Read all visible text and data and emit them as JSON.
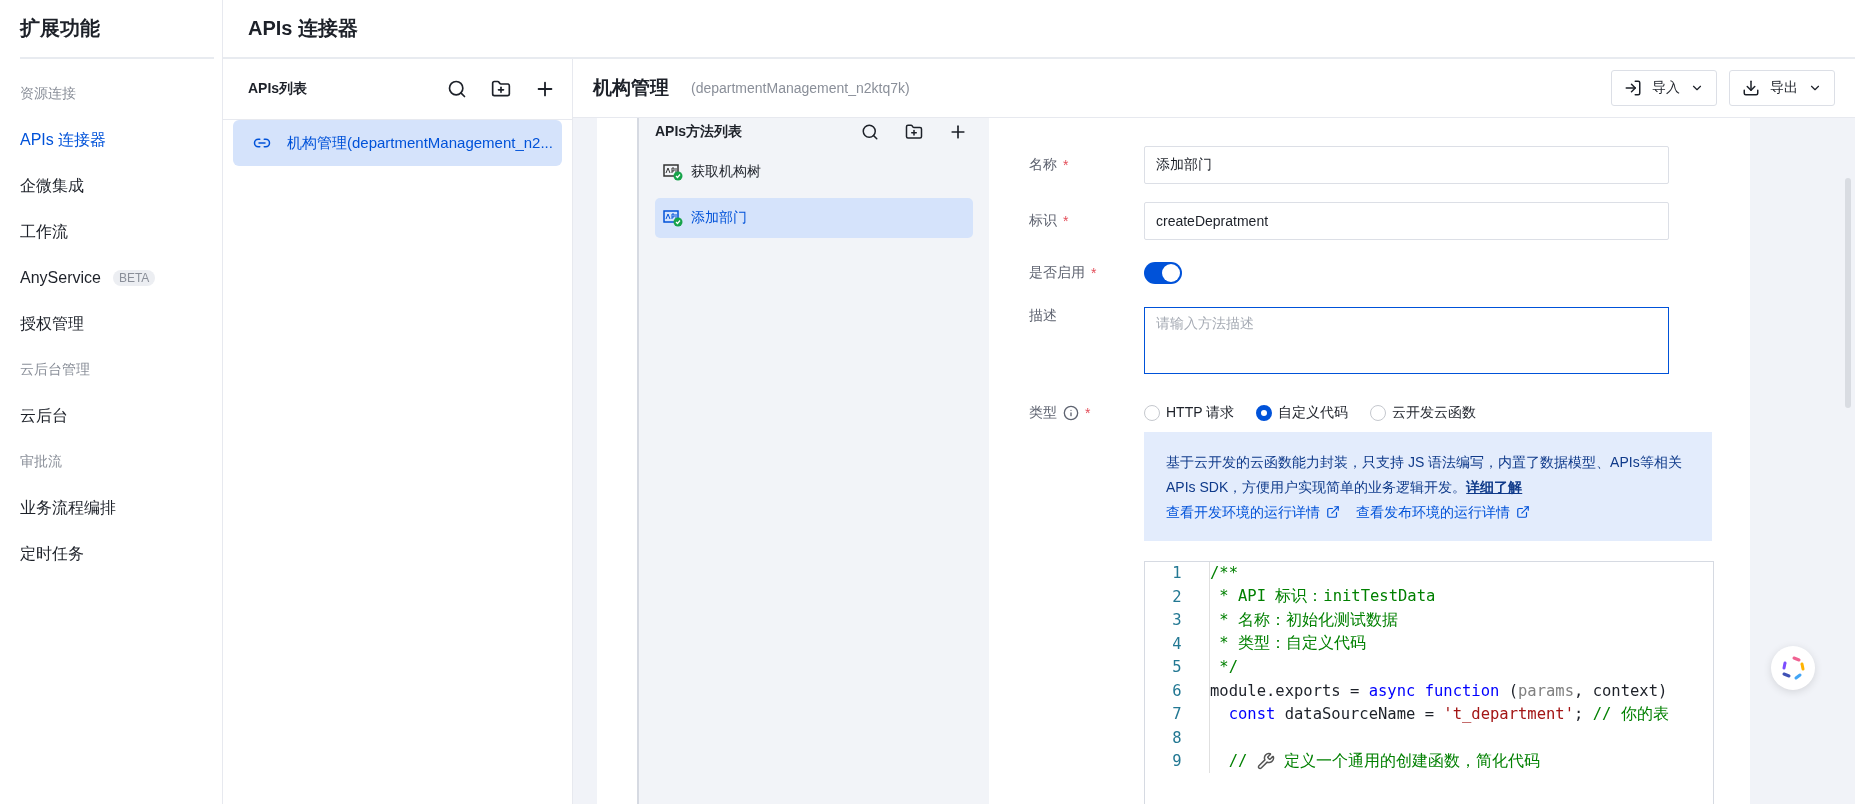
{
  "sidebar": {
    "title": "扩展功能",
    "groups": [
      {
        "heading": "资源连接",
        "items": [
          {
            "label": "APIs 连接器",
            "selected": true
          },
          {
            "label": "企微集成",
            "selected": false
          },
          {
            "label": "工作流",
            "selected": false
          },
          {
            "label": "AnyService",
            "badge": "BETA",
            "selected": false
          },
          {
            "label": "授权管理",
            "selected": false
          }
        ]
      },
      {
        "heading": "云后台管理",
        "items": [
          {
            "label": "云后台",
            "selected": false
          }
        ]
      },
      {
        "heading": "审批流",
        "items": [
          {
            "label": "业务流程编排",
            "selected": false
          },
          {
            "label": "定时任务",
            "selected": false
          }
        ]
      }
    ]
  },
  "page_title": "APIs 连接器",
  "apis_list": {
    "title": "APIs列表",
    "items": [
      {
        "label": "机构管理(departmentManagement_n2...",
        "selected": true
      }
    ]
  },
  "detail_header": {
    "title": "机构管理",
    "subtitle": "(departmentManagement_n2ktq7k)",
    "buttons": [
      {
        "kind": "import",
        "label": "导入"
      },
      {
        "kind": "export",
        "label": "导出"
      }
    ]
  },
  "methods_list": {
    "title": "APIs方法列表",
    "items": [
      {
        "label": "获取机构树",
        "selected": false
      },
      {
        "label": "添加部门",
        "selected": true
      }
    ]
  },
  "form": {
    "fields": [
      {
        "kind": "text",
        "label": "名称",
        "required_mark": "*",
        "value": "添加部门"
      },
      {
        "kind": "text",
        "label": "标识",
        "required_mark": "*",
        "value": "createDepratment"
      },
      {
        "kind": "switch",
        "label": "是否启用",
        "required_mark": "*",
        "on": true
      },
      {
        "kind": "textarea",
        "label": "描述",
        "placeholder": "请输入方法描述"
      },
      {
        "kind": "radio",
        "label": "类型",
        "required_mark": "*",
        "info": true,
        "options": [
          {
            "label": "HTTP 请求",
            "selected": false
          },
          {
            "label": "自定义代码",
            "selected": true
          },
          {
            "label": "云开发云函数",
            "selected": false
          }
        ]
      }
    ]
  },
  "info_box": {
    "text": "基于云开发的云函数能力封装，只支持 JS 语法编写，内置了数据模型、APIs等相关 APIs SDK，方便用户实现简单的业务逻辑开发。",
    "link": "详细了解",
    "links": [
      "查看开发环境的运行详情",
      "查看发布环境的运行详情"
    ]
  },
  "code_editor": {
    "lines": [
      {
        "number": "1",
        "tokens": [
          {
            "kind": "comment",
            "text": "/**"
          }
        ]
      },
      {
        "number": "2",
        "tokens": [
          {
            "kind": "comment",
            "text": " * API 标识：initTestData"
          }
        ]
      },
      {
        "number": "3",
        "tokens": [
          {
            "kind": "comment",
            "text": " * 名称：初始化测试数据"
          }
        ]
      },
      {
        "number": "4",
        "tokens": [
          {
            "kind": "comment",
            "text": " * 类型：自定义代码"
          }
        ]
      },
      {
        "number": "5",
        "tokens": [
          {
            "kind": "comment",
            "text": " */"
          }
        ]
      },
      {
        "number": "6",
        "tokens": [
          {
            "kind": "plain",
            "text": "module.exports = "
          },
          {
            "kind": "keyword",
            "text": "async"
          },
          {
            "kind": "keyword",
            "text": " function"
          },
          {
            "kind": "plain",
            "text": " ("
          },
          {
            "kind": "param",
            "text": "params"
          },
          {
            "kind": "plain",
            "text": ", context)"
          }
        ]
      },
      {
        "number": "7",
        "indent": true,
        "tokens": [
          {
            "kind": "keyword",
            "text": "const"
          },
          {
            "kind": "plain",
            "text": " dataSourceName = "
          },
          {
            "kind": "string",
            "text": "'t_department'"
          },
          {
            "kind": "plain",
            "text": "; "
          },
          {
            "kind": "comment",
            "text": "// 你的表"
          }
        ]
      },
      {
        "number": "8"
      },
      {
        "number": "9",
        "tokens": [
          {
            "kind": "comment",
            "text": "  // "
          },
          {
            "kind": "tool_icon"
          },
          {
            "kind": "comment",
            "text": " 定义一个通用的创建函数，简化代码"
          }
        ]
      }
    ]
  }
}
